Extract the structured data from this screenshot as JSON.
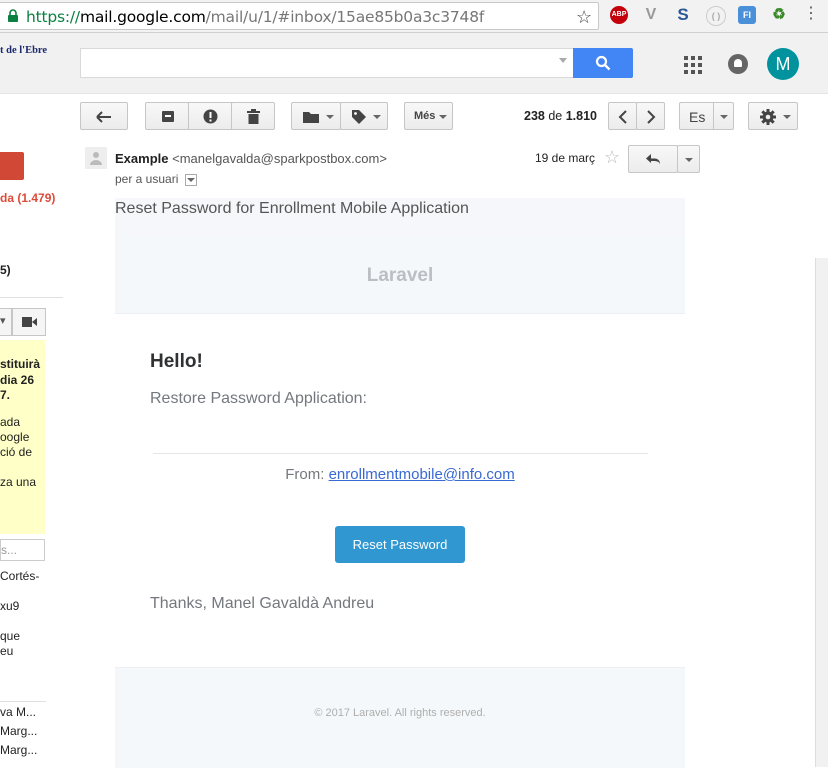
{
  "browser": {
    "url_scheme": "https://",
    "url_domain": "mail.google.com",
    "url_path": "/mail/u/1/#inbox/15ae85b0a3c3748f",
    "extensions": [
      "ABP",
      "V",
      "S",
      "( )",
      "FI",
      "♻"
    ]
  },
  "header": {
    "logo_text": "t de l'Ebre",
    "avatar_letter": "M"
  },
  "toolbar": {
    "more_label": "Més",
    "pager_start": "238",
    "pager_of": " de ",
    "pager_total": "1.810",
    "lang_label": "Es"
  },
  "sidebar": {
    "inbox_label": "da (1.479)",
    "other_count": "5)",
    "notice_lines": [
      "stituirà",
      "dia 26",
      "7.",
      "",
      "ada",
      "oogle",
      "ció de",
      "",
      "za una"
    ],
    "search_placeholder": "s...",
    "contacts": [
      "Cortés-",
      "xu9",
      "que",
      "eu",
      "va M...",
      "Marg...",
      "Marg..."
    ]
  },
  "email": {
    "sender_name": "Example",
    "sender_email": "<manelgavalda@sparkpostbox.com>",
    "to_label": "per a usuari",
    "date": "19 de març",
    "subject": "Reset Password for Enrollment Mobile Application",
    "brand": "Laravel",
    "greeting": "Hello!",
    "intro": "Restore Password Application:",
    "from_label": "From: ",
    "from_email": "enrollmentmobile@info.com",
    "button_label": "Reset Password",
    "signoff": "Thanks, Manel Gavaldà Andreu",
    "footer": "© 2017 Laravel. All rights reserved."
  },
  "colors": {
    "accent": "#4285f4",
    "compose": "#d14836",
    "avatar": "#00939e",
    "button": "#3097d1",
    "link": "#3869d4"
  }
}
